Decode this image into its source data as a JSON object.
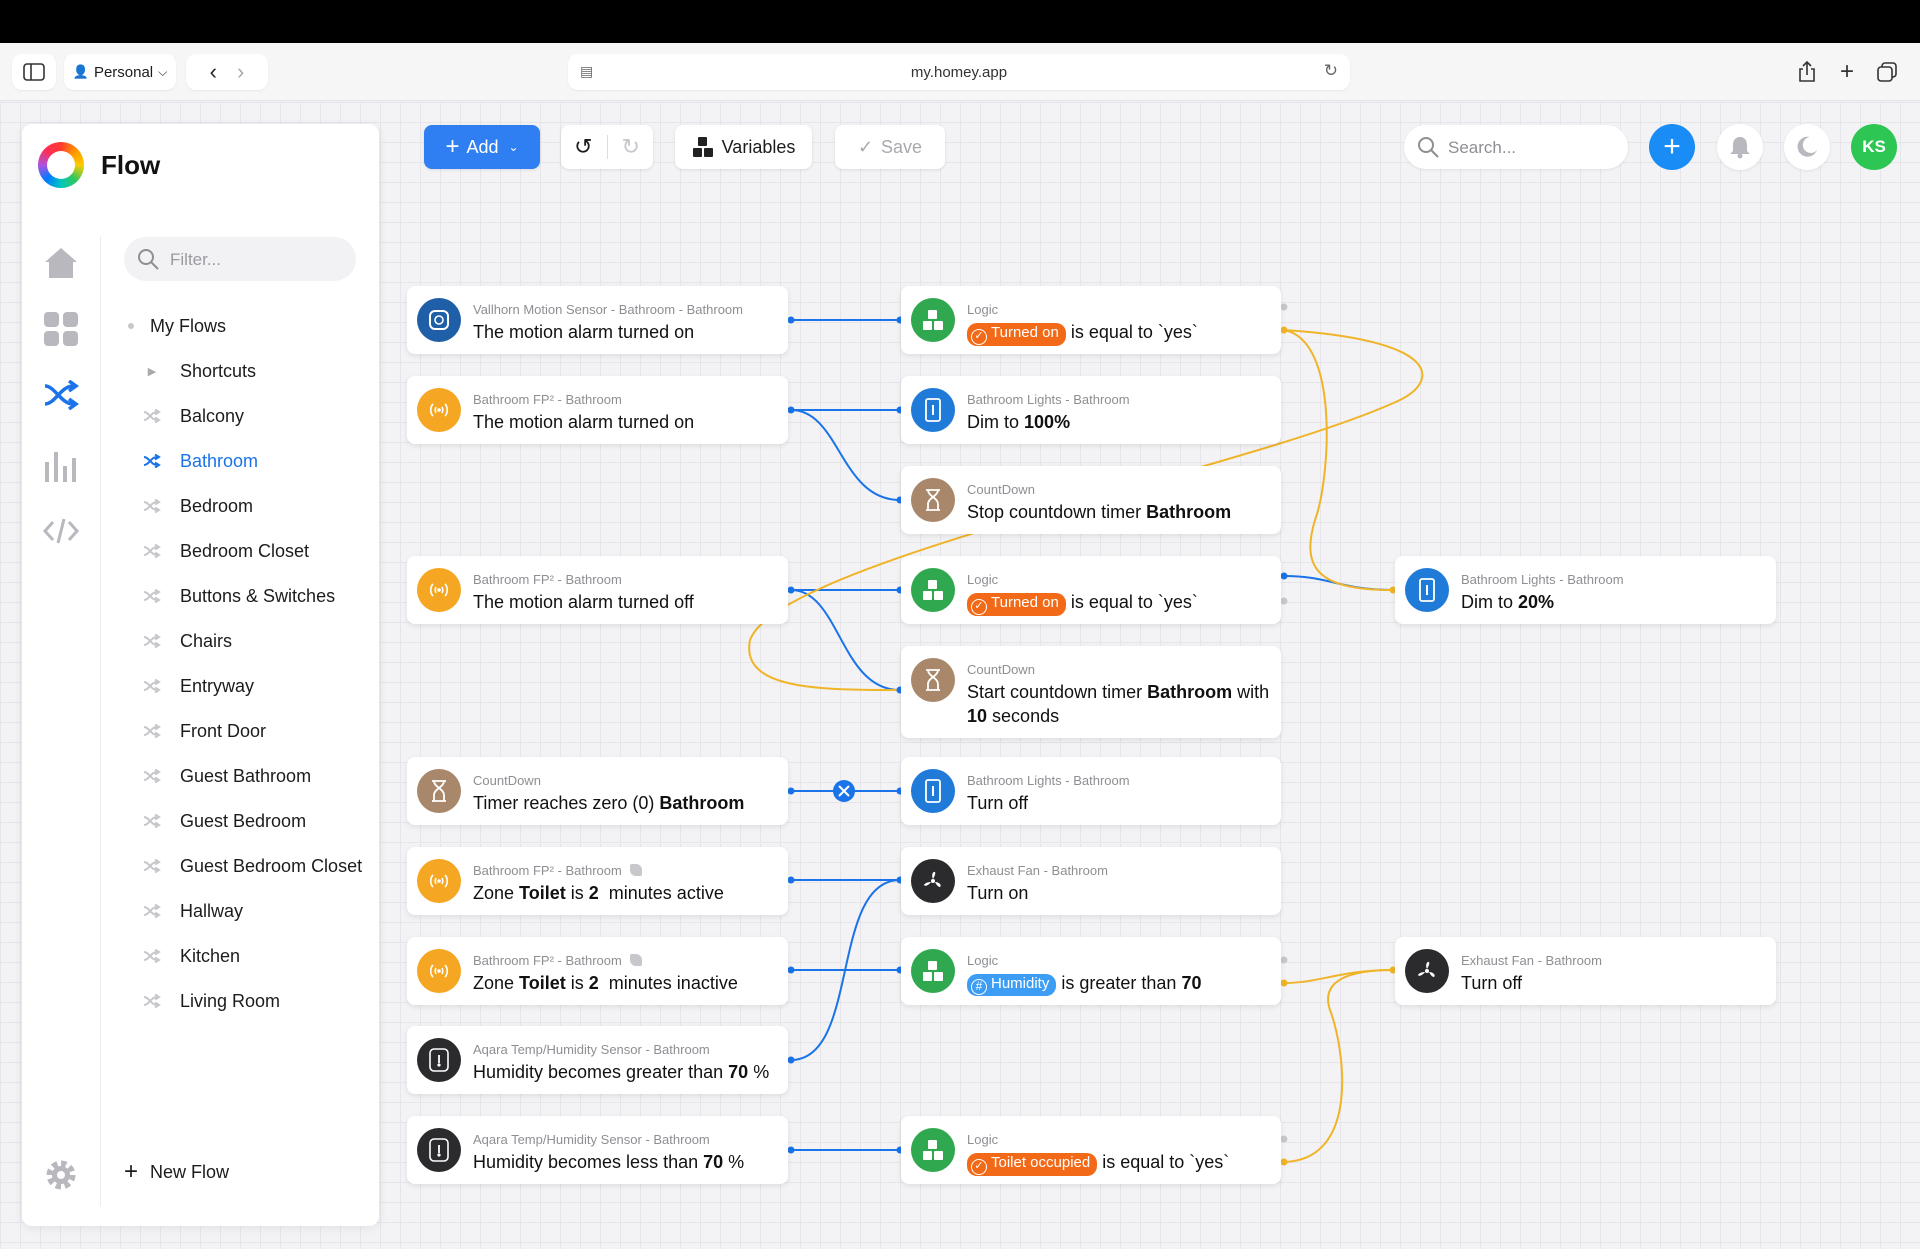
{
  "browser": {
    "profile_label": "Personal",
    "url": "my.homey.app"
  },
  "app": {
    "title": "Flow"
  },
  "sidebar": {
    "filter_placeholder": "Filter...",
    "my_flows_label": "My Flows",
    "items": [
      {
        "label": "Shortcuts"
      },
      {
        "label": "Balcony"
      },
      {
        "label": "Bathroom"
      },
      {
        "label": "Bedroom"
      },
      {
        "label": "Bedroom Closet"
      },
      {
        "label": "Buttons & Switches"
      },
      {
        "label": "Chairs"
      },
      {
        "label": "Entryway"
      },
      {
        "label": "Front Door"
      },
      {
        "label": "Guest Bathroom"
      },
      {
        "label": "Guest Bedroom"
      },
      {
        "label": "Guest Bedroom Closet"
      },
      {
        "label": "Hallway"
      },
      {
        "label": "Kitchen"
      },
      {
        "label": "Living Room"
      }
    ],
    "new_flow_label": "New Flow"
  },
  "toolbar": {
    "add_label": "Add",
    "variables_label": "Variables",
    "save_label": "Save",
    "search_placeholder": "Search...",
    "avatar_initials": "KS"
  },
  "colors": {
    "accent": "#2f7ff3",
    "wire_blue": "#1a73e8",
    "wire_yellow": "#f0b429",
    "tag_orange": "#f26a17",
    "tag_blue": "#3d9df4"
  },
  "cards": {
    "c1": {
      "sub": "Vallhorn Motion Sensor - Bathroom - Bathroom",
      "text": "The motion alarm turned on"
    },
    "c2": {
      "sub": "Bathroom FP² - Bathroom",
      "text": "The motion alarm turned on"
    },
    "c3": {
      "sub": "Bathroom FP² - Bathroom",
      "text": "The motion alarm turned off"
    },
    "c4": {
      "sub": "CountDown",
      "text": "Timer reaches zero (0)",
      "bold": "Bathroom"
    },
    "c5": {
      "sub": "Bathroom FP² - Bathroom",
      "pre": "Zone",
      "b1": "Toilet",
      "mid": "is",
      "b2": "2",
      "post": "minutes active"
    },
    "c6": {
      "sub": "Bathroom FP² - Bathroom",
      "pre": "Zone",
      "b1": "Toilet",
      "mid": "is",
      "b2": "2",
      "post": "minutes inactive"
    },
    "c7": {
      "sub": "Aqara Temp/Humidity Sensor - Bathroom",
      "text": "Humidity becomes greater than",
      "bold": "70",
      "post": "%"
    },
    "c8": {
      "sub": "Aqara Temp/Humidity Sensor - Bathroom",
      "text": "Humidity becomes less than",
      "bold": "70",
      "post": "%"
    },
    "m1": {
      "sub": "Logic",
      "tag": "Turned on",
      "text": "is equal to `yes`"
    },
    "m2": {
      "sub": "Bathroom Lights - Bathroom",
      "text": "Dim to",
      "bold": "100%"
    },
    "m3": {
      "sub": "CountDown",
      "text": "Stop countdown timer",
      "bold": "Bathroom"
    },
    "m4": {
      "sub": "Logic",
      "tag": "Turned on",
      "text": "is equal to `yes`"
    },
    "m5": {
      "sub": "CountDown",
      "text": "Start countdown timer",
      "bold": "Bathroom",
      "post": "with",
      "line2_bold": "10",
      "line2": "seconds"
    },
    "m6": {
      "sub": "Bathroom Lights - Bathroom",
      "text": "Turn off"
    },
    "m7": {
      "sub": "Exhaust Fan - Bathroom",
      "text": "Turn on"
    },
    "m8": {
      "sub": "Logic",
      "tag": "Humidity",
      "text": "is greater than",
      "bold": "70"
    },
    "m9": {
      "sub": "Logic",
      "tag": "Toilet occupied",
      "text": "is equal to `yes`"
    },
    "r1": {
      "sub": "Bathroom Lights - Bathroom",
      "text": "Dim to",
      "bold": "20%"
    },
    "r2": {
      "sub": "Exhaust Fan - Bathroom",
      "text": "Turn off"
    }
  }
}
